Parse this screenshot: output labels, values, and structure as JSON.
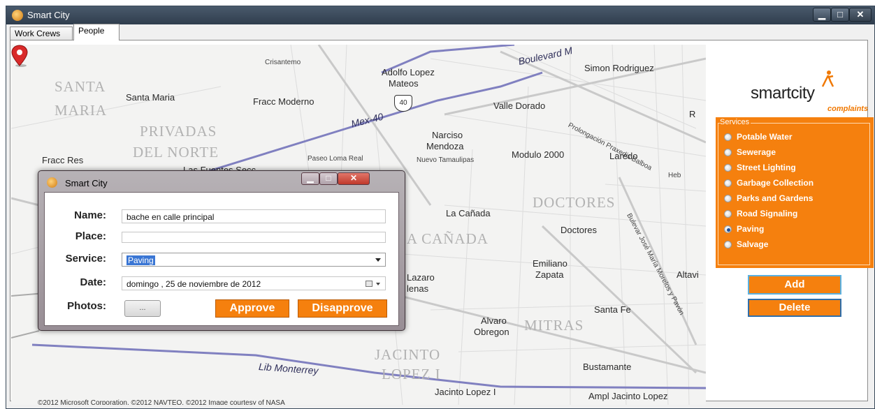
{
  "window": {
    "title": "Smart City"
  },
  "tabs": [
    {
      "label": "Work Crews"
    },
    {
      "label": "People"
    }
  ],
  "map": {
    "labels": {
      "crisantemo": "Crisantemo",
      "adolfo": "Adolfo Lopez",
      "mateos": "Mateos",
      "simon": "Simon Rodriguez",
      "santa_big": "SANTA",
      "maria_big": "MARIA",
      "santa_maria": "Santa Maria",
      "fracc_moderno": "Fracc Moderno",
      "shield": "40",
      "valle_dorado": "Valle Dorado",
      "prolongacion": "Prolongación Praxedis Balboa",
      "boulevard": "Boulevard M",
      "privadas": "PRIVADAS",
      "del_norte": "DEL NORTE",
      "mex40": "Mex-40",
      "narciso": "Narciso",
      "mendoza": "Mendoza",
      "modulo": "Modulo 2000",
      "laredo": "Laredo",
      "fracc_res": "Fracc Res",
      "paseo": "Paseo Loma Real",
      "nuevo": "Nuevo Tamaulipas",
      "las_fuentes": "Las Fuentes Secc",
      "heb": "Heb",
      "doctores_big": "DOCTORES",
      "la_canada": "La Cañada",
      "doctores": "Doctores",
      "la_canada_big": "LA CAÑADA",
      "bulevar_jose": "Bulevar José María Morelos y Pavón",
      "emiliano": "Emiliano",
      "zapata": "Zapata",
      "altavi": "Altavi",
      "lazaro": "Lazaro",
      "lenas": "lenas",
      "santa_fe": "Santa Fe",
      "alvaro": "Alvaro",
      "obregon": "Obregon",
      "mitras_big": "MITRAS",
      "jacinto_big": "JACINTO",
      "lopez_big": "LOPEZ I",
      "lib_monterrey": "Lib Monterrey",
      "bustamante": "Bustamante",
      "jacinto_lopez": "Jacinto Lopez I",
      "ampl_jacinto": "Ampl Jacinto Lopez",
      "r_edge": "R"
    },
    "copyright": "©2012 Microsoft Corporation, ©2012 NAVTEQ, ©2012 Image courtesy of NASA"
  },
  "logo": {
    "text": "smartcity",
    "subtitle": "complaints"
  },
  "services": {
    "legend": "Services",
    "items": [
      {
        "label": "Potable Water",
        "checked": false
      },
      {
        "label": "Sewerage",
        "checked": false
      },
      {
        "label": "Street Lighting",
        "checked": false
      },
      {
        "label": "Garbage Collection",
        "checked": false
      },
      {
        "label": "Parks and Gardens",
        "checked": false
      },
      {
        "label": "Road Signaling",
        "checked": false
      },
      {
        "label": "Paving",
        "checked": true
      },
      {
        "label": "Salvage",
        "checked": false
      }
    ]
  },
  "buttons": {
    "add": "Add",
    "delete": "Delete"
  },
  "dialog": {
    "title": "Smart City",
    "name_label": "Name:",
    "name_value": "bache en calle principal",
    "place_label": "Place:",
    "place_value": "",
    "service_label": "Service:",
    "service_value": "Paving",
    "date_label": "Date:",
    "date_value": "domingo , 25 de noviembre de 2012",
    "photos_label": "Photos:",
    "photos_button": "...",
    "approve": "Approve",
    "disapprove": "Disapprove"
  },
  "colors": {
    "accent": "#f5800e",
    "selection": "#3a76d4",
    "pin": "#d92a2a"
  }
}
